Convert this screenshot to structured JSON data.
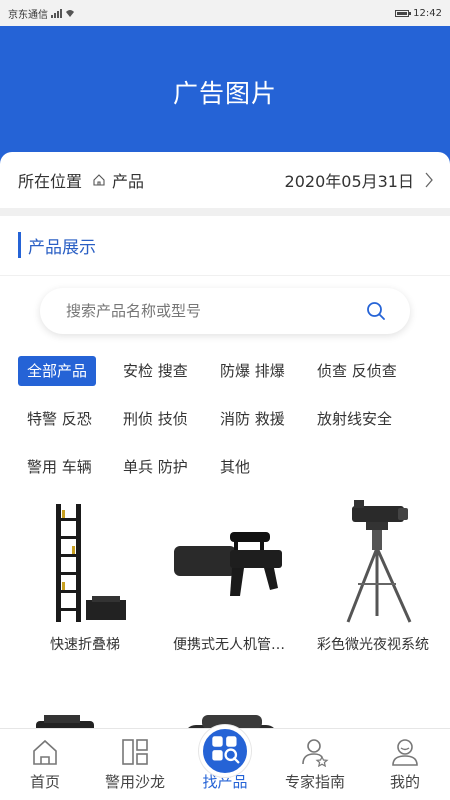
{
  "status_bar": {
    "carrier": "京东通信",
    "time": "12:42"
  },
  "banner": {
    "title": "广告图片"
  },
  "location": {
    "label": "所在位置",
    "current": "产品",
    "date": "2020年05月31日"
  },
  "section": {
    "title": "产品展示"
  },
  "search": {
    "placeholder": "搜索产品名称或型号"
  },
  "categories": [
    {
      "label": "全部产品",
      "active": true
    },
    {
      "label": "安检 搜查"
    },
    {
      "label": "防爆 排爆"
    },
    {
      "label": "侦查 反侦查"
    },
    {
      "label": "特警 反恐"
    },
    {
      "label": "刑侦 技侦"
    },
    {
      "label": "消防 救援"
    },
    {
      "label": "放射线安全"
    },
    {
      "label": "警用 车辆"
    },
    {
      "label": "单兵 防护"
    },
    {
      "label": "其他"
    }
  ],
  "products": [
    {
      "name": "快速折叠梯"
    },
    {
      "name": "便携式无人机管…"
    },
    {
      "name": "彩色微光夜视系统"
    }
  ],
  "bottom_nav": [
    {
      "label": "首页",
      "icon": "home-icon"
    },
    {
      "label": "警用沙龙",
      "icon": "grid-icon"
    },
    {
      "label": "找产品",
      "icon": "find-product-icon",
      "active": true
    },
    {
      "label": "专家指南",
      "icon": "expert-icon"
    },
    {
      "label": "我的",
      "icon": "user-icon"
    }
  ],
  "colors": {
    "primary": "#2563d6",
    "background": "#ffffff",
    "separator": "#f0f0f0"
  }
}
